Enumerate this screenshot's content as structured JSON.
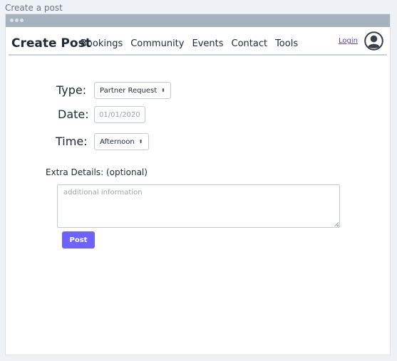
{
  "page": {
    "frame_title": "Create a post"
  },
  "navbar": {
    "brand": "Create Post",
    "links": [
      "Bookings",
      "Community",
      "Events",
      "Contact",
      "Tools"
    ],
    "login": "Login",
    "avatar_icon": "user-circle-icon"
  },
  "form": {
    "type": {
      "label": "Type:",
      "value": "Partner Request"
    },
    "date": {
      "label": "Date:",
      "placeholder": "01/01/2020"
    },
    "time": {
      "label": "Time:",
      "value": "Afternoon"
    },
    "extra": {
      "label": "Extra Details: (optional)",
      "placeholder": "additional information"
    },
    "submit_label": "Post"
  },
  "colors": {
    "accent": "#6c63ff",
    "login_link": "#5b3fd6",
    "titlebar": "#a6b2bd"
  }
}
